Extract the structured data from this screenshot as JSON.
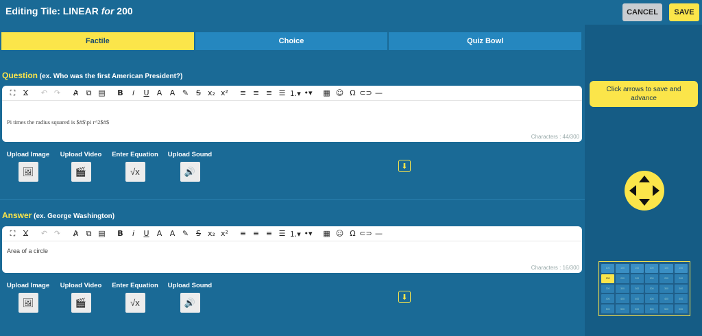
{
  "header": {
    "title_prefix": "Editing Tile: LINEAR ",
    "title_for": "for",
    "title_points": " 200",
    "cancel_label": "CANCEL",
    "save_label": "SAVE"
  },
  "tabs": [
    {
      "label": "Factile",
      "active": true
    },
    {
      "label": "Choice",
      "active": false
    },
    {
      "label": "Quiz Bowl",
      "active": false
    }
  ],
  "question": {
    "label": "Question",
    "example": "(ex. Who was the first American President?)",
    "content": "Pi times the radius squared is $#$\\pi r^2$#$",
    "char_count": "Characters : 44/300"
  },
  "answer": {
    "label": "Answer",
    "example": "(ex. George Washington)",
    "content": "Area of a circle",
    "char_count": "Characters : 16/300"
  },
  "uploads": {
    "image": "Upload Image",
    "video": "Upload Video",
    "equation": "Enter Equation",
    "sound": "Upload Sound"
  },
  "toolbar_icons": [
    "fullscreen-icon",
    "clear-format-icon",
    "undo-icon",
    "redo-icon",
    "spellcheck-icon",
    "copy-icon",
    "paste-icon",
    "bold-icon",
    "italic-icon",
    "underline-icon",
    "font-size-icon",
    "text-color-icon",
    "highlight-icon",
    "strikethrough-icon",
    "subscript-icon",
    "superscript-icon",
    "align-left-icon",
    "align-center-icon",
    "align-right-icon",
    "justify-icon",
    "ordered-list-icon",
    "unordered-list-icon",
    "table-icon",
    "emoji-icon",
    "special-char-icon",
    "link-icon",
    "horizontal-rule-icon"
  ],
  "sidebar": {
    "hint": "Click arrows to save and advance"
  },
  "minimap": {
    "current_row": 1,
    "current_col": 0,
    "cell_text": "100",
    "cell_values": [
      [
        "100",
        "100",
        "100",
        "100",
        "100",
        "100"
      ],
      [
        "200",
        "200",
        "200",
        "200",
        "200",
        "200"
      ],
      [
        "300",
        "300",
        "300",
        "300",
        "300",
        "300"
      ],
      [
        "400",
        "400",
        "400",
        "400",
        "400",
        "400"
      ],
      [
        "500",
        "500",
        "500",
        "500",
        "500",
        "500"
      ]
    ]
  },
  "colors": {
    "background": "#1a6a96",
    "accent": "#fbe54a",
    "tab_inactive": "#2587bf"
  }
}
